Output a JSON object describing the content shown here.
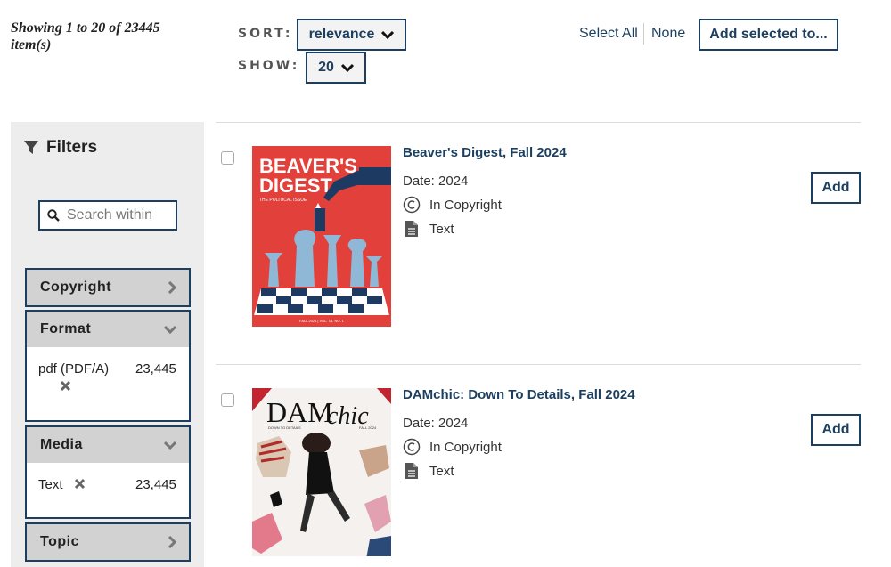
{
  "results_summary": "Showing 1 to 20 of 23445 item(s)",
  "sort": {
    "label": "SORT:",
    "value": "relevance"
  },
  "show": {
    "label": "SHOW:",
    "value": "20"
  },
  "selection": {
    "select_all": "Select All",
    "none": "None",
    "add_selected": "Add selected to..."
  },
  "filters": {
    "title": "Filters",
    "search_placeholder": "Search within",
    "facets": [
      {
        "name": "Copyright",
        "expanded": false
      },
      {
        "name": "Format",
        "expanded": true,
        "items": [
          {
            "label": "pdf (PDF/A)",
            "count": "23,445"
          }
        ]
      },
      {
        "name": "Media",
        "expanded": true,
        "items": [
          {
            "label": "Text",
            "count": "23,445"
          }
        ]
      },
      {
        "name": "Topic",
        "expanded": false
      }
    ]
  },
  "results": [
    {
      "title": "Beaver's Digest, Fall 2024",
      "date": "Date: 2024",
      "rights": "In Copyright",
      "type": "Text",
      "add_label": "Add",
      "cover": {
        "masthead_line1": "BEAVER'S",
        "masthead_line2": "DIGEST",
        "subtitle": "THE POLITICAL ISSUE",
        "footer": "FALL 2024 | VOL. 18, NO. 1",
        "bg": "#e2403b"
      }
    },
    {
      "title": "DAMchic: Down To Details, Fall 2024",
      "date": "Date: 2024",
      "rights": "In Copyright",
      "type": "Text",
      "add_label": "Add",
      "cover": {
        "masthead_a": "DAM",
        "masthead_b": "chic",
        "subtitle": "DOWN TO DETAILS",
        "issue": "FALL 2024"
      }
    }
  ],
  "colors": {
    "primary": "#1d3f5f",
    "sidebar_bg": "#ededed",
    "facet_head_bg": "#d2d2d2"
  }
}
